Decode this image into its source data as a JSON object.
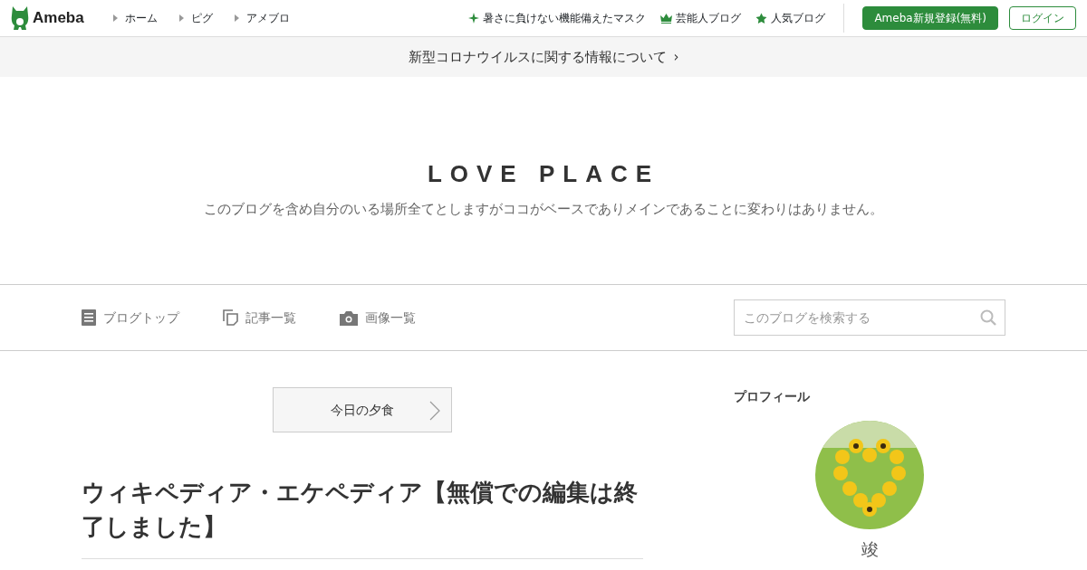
{
  "header": {
    "logo": "Ameba",
    "nav": [
      {
        "label": "ホーム"
      },
      {
        "label": "ピグ"
      },
      {
        "label": "アメブロ"
      }
    ],
    "links": [
      {
        "kind": "sparkle",
        "label": "暑さに負けない機能備えたマスク"
      },
      {
        "kind": "crown",
        "label": "芸能人ブログ"
      },
      {
        "kind": "star",
        "label": "人気ブログ"
      }
    ],
    "register_button": "Ameba新規登録(無料)",
    "login_button": "ログイン"
  },
  "notice": {
    "text": "新型コロナウイルスに関する情報について",
    "arrow": "›"
  },
  "blog": {
    "title": "LOVE PLACE",
    "description": "このブログを含め自分のいる場所全てとしますがココがベースでありメインであることに変わりはありません。"
  },
  "blog_nav": [
    {
      "kind": "doc",
      "label": "ブログトップ"
    },
    {
      "kind": "pages",
      "label": "記事一覧"
    },
    {
      "kind": "camera",
      "label": "画像一覧"
    }
  ],
  "search": {
    "placeholder": "このブログを検索する"
  },
  "article": {
    "theme": "今日の夕食",
    "title": "ウィキペディア・エケペディア【無償での編集は終了しました】"
  },
  "profile": {
    "heading": "プロフィール",
    "name": "竣"
  }
}
